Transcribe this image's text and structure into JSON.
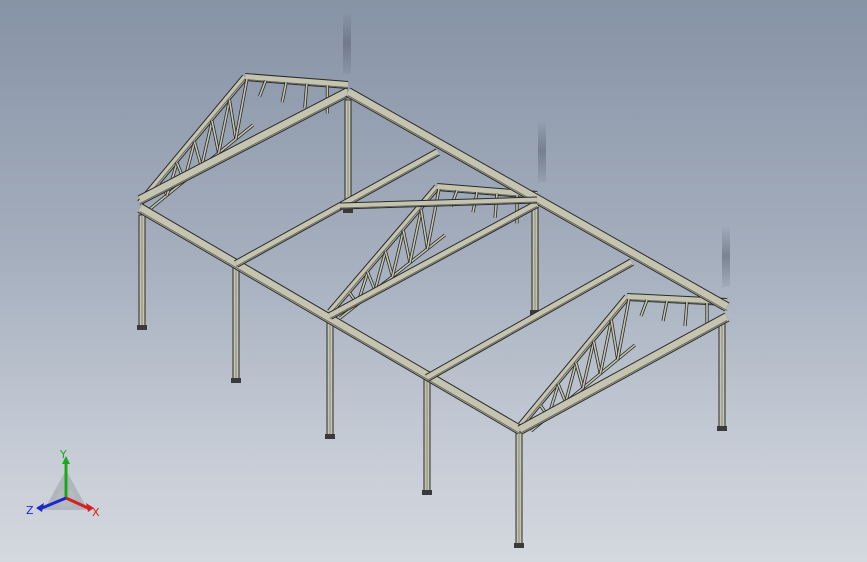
{
  "viewport": {
    "background_top": "#8793a6",
    "background_bottom": "#d4d8df",
    "model_fill": "#c4c4b0",
    "model_edge": "#2a2a2a",
    "shadow_color": "#5a6270"
  },
  "triad": {
    "x_label": "X",
    "y_label": "Y",
    "z_label": "Z",
    "x_color": "#d42020",
    "y_color": "#1ca81c",
    "z_color": "#1c28c8"
  }
}
